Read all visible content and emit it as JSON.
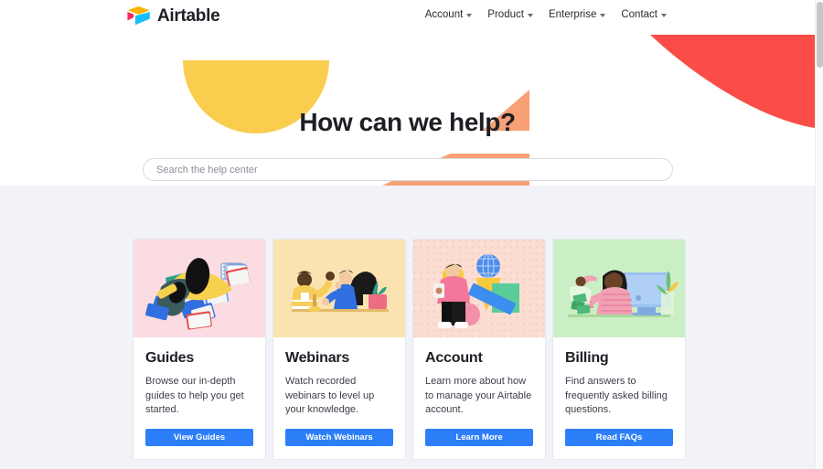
{
  "header": {
    "logo_text": "Airtable",
    "logo_icon": "airtable-logo-icon",
    "nav": [
      {
        "label": "Account",
        "icon": "chevron-down-icon"
      },
      {
        "label": "Product",
        "icon": "chevron-down-icon"
      },
      {
        "label": "Enterprise",
        "icon": "chevron-down-icon"
      },
      {
        "label": "Contact",
        "icon": "chevron-down-icon"
      }
    ]
  },
  "hero": {
    "title": "How can we help?",
    "search_placeholder": "Search the help center",
    "search_value": "",
    "decorations": [
      {
        "name": "yellow-semicircle",
        "color": "#F9CD4E"
      },
      {
        "name": "red-swoosh",
        "color": "#FA4D47"
      },
      {
        "name": "orange-triangle-small",
        "color": "#F8A177"
      },
      {
        "name": "orange-triangle-large",
        "color": "#F8A177"
      },
      {
        "name": "teal-rectangle",
        "color": "#068F76"
      },
      {
        "name": "blue-dome",
        "color": "#7EACF0"
      }
    ]
  },
  "cards": [
    {
      "title": "Guides",
      "description": "Browse our in-depth guides to help you get started.",
      "button_label": "View Guides",
      "art_name": "guides-illustration",
      "art_bg": "#FBDCE2"
    },
    {
      "title": "Webinars",
      "description": "Watch recorded webinars to level up your knowledge.",
      "button_label": "Watch Webinars",
      "art_name": "webinars-illustration",
      "art_bg": "#FAE3B0"
    },
    {
      "title": "Account",
      "description": "Learn more about how to manage your Airtable account.",
      "button_label": "Learn More",
      "art_name": "account-illustration",
      "art_bg": "#FBDDD2"
    },
    {
      "title": "Billing",
      "description": "Find answers to frequently asked billing questions.",
      "button_label": "Read FAQs",
      "art_name": "billing-illustration",
      "art_bg": "#CBEFC4"
    }
  ],
  "theme": {
    "accent_blue": "#2D7FF9",
    "page_background": "#F2F3F8",
    "surface": "#FFFFFF",
    "text_primary": "#1D1F25"
  },
  "scrollbar": {
    "name": "vertical-scrollbar"
  }
}
